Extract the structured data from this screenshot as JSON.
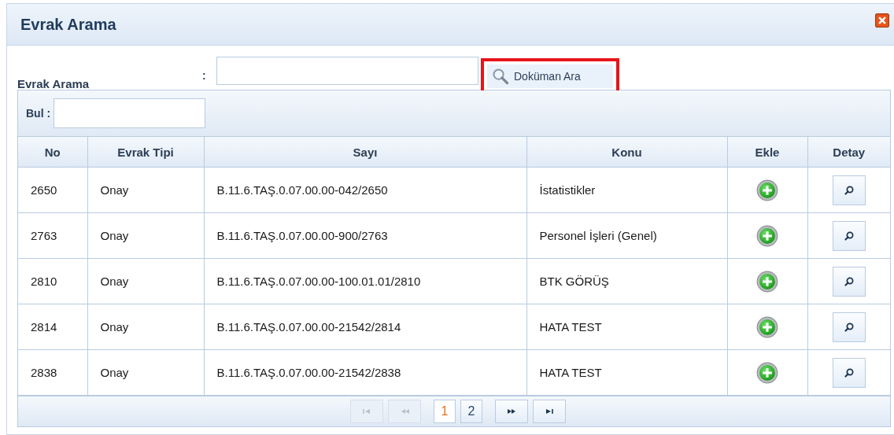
{
  "window": {
    "title": "Evrak Arama"
  },
  "search": {
    "label": "Evrak Arama",
    "colon": ":",
    "button": {
      "label": "Doküman Ara",
      "highlighted": true
    }
  },
  "filter": {
    "label": "Bul :"
  },
  "table": {
    "columns": [
      "No",
      "Evrak Tipi",
      "Sayı",
      "Konu",
      "Ekle",
      "Detay"
    ],
    "rows": [
      {
        "no": "2650",
        "type": "Onay",
        "number": "B.11.6.TAŞ.0.07.00.00-042/2650",
        "subject": "İstatistikler"
      },
      {
        "no": "2763",
        "type": "Onay",
        "number": "B.11.6.TAŞ.0.07.00.00-900/2763",
        "subject": "Personel İşleri (Genel)"
      },
      {
        "no": "2810",
        "type": "Onay",
        "number": "B.11.6.TAŞ.0.07.00.00-100.01.01/2810",
        "subject": "BTK GÖRÜŞ"
      },
      {
        "no": "2814",
        "type": "Onay",
        "number": "B.11.6.TAŞ.0.07.00.00-21542/2814",
        "subject": "HATA TEST"
      },
      {
        "no": "2838",
        "type": "Onay",
        "number": "B.11.6.TAŞ.0.07.00.00-21542/2838",
        "subject": "HATA TEST"
      }
    ]
  },
  "pager": {
    "nav": [
      {
        "kind": "first",
        "disabled": true
      },
      {
        "kind": "prev",
        "disabled": true
      },
      {
        "kind": "next",
        "disabled": false
      },
      {
        "kind": "last",
        "disabled": false
      }
    ],
    "pages": [
      {
        "label": "1",
        "selected": true
      },
      {
        "label": "2",
        "selected": false
      }
    ]
  }
}
